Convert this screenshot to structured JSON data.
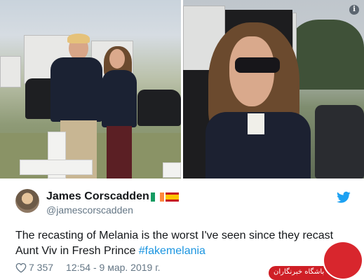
{
  "photos": {
    "left_alt": "Trump and Melania by white cross",
    "right_alt": "Melania in sunglasses close-up"
  },
  "info_icon": {
    "glyph": "i",
    "name": "info-icon"
  },
  "tweet": {
    "author_name": "James Corscadden",
    "flags": [
      "ireland-flag",
      "spain-flag"
    ],
    "handle": "@jamescorscadden",
    "text_line1": "The recasting of Melania is the worst I've seen since they recast",
    "text_line2_prefix": "Aunt Viv in Fresh Prince ",
    "hashtag": "#fakemelania",
    "likes": "7 357",
    "timestamp": "12:54 - 9 мар. 2019 г.",
    "source_icon": "twitter-bird-icon",
    "colors": {
      "hashtag": "#1b95e0",
      "twitter": "#1da1f2",
      "muted": "#657786"
    }
  },
  "watermark": {
    "text": "باشگاه خبرنگاران",
    "color": "#cf1f26"
  }
}
